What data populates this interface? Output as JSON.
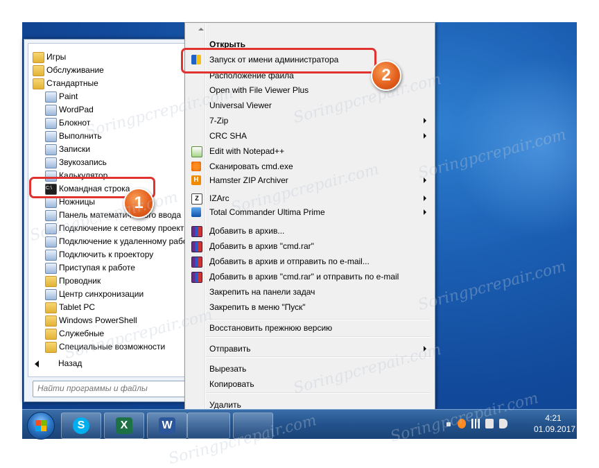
{
  "start_menu": {
    "programs": [
      {
        "label": "Игры",
        "icon": "folder-icon",
        "kind": "folder"
      },
      {
        "label": "Обслуживание",
        "icon": "folder-icon",
        "kind": "folder"
      },
      {
        "label": "Стандартные",
        "icon": "folder-icon",
        "kind": "folder-open"
      },
      {
        "label": "Paint",
        "icon": "paint-icon",
        "kind": "app"
      },
      {
        "label": "WordPad",
        "icon": "wordpad-icon",
        "kind": "app"
      },
      {
        "label": "Блокнот",
        "icon": "notepad-icon",
        "kind": "app"
      },
      {
        "label": "Выполнить",
        "icon": "run-icon",
        "kind": "app"
      },
      {
        "label": "Записки",
        "icon": "sticky-notes-icon",
        "kind": "app"
      },
      {
        "label": "Звукозапись",
        "icon": "sound-recorder-icon",
        "kind": "app"
      },
      {
        "label": "Калькулятор",
        "icon": "calculator-icon",
        "kind": "app"
      },
      {
        "label": "Командная строка",
        "icon": "cmd-icon",
        "kind": "cmd"
      },
      {
        "label": "Ножницы",
        "icon": "scissors-icon",
        "kind": "app"
      },
      {
        "label": "Панель математического ввода",
        "icon": "math-input-icon",
        "kind": "app"
      },
      {
        "label": "Подключение к сетевому проект",
        "icon": "network-projector-icon",
        "kind": "app"
      },
      {
        "label": "Подключение к удаленному рабо",
        "icon": "remote-desktop-icon",
        "kind": "app"
      },
      {
        "label": "Подключить к проектору",
        "icon": "projector-icon",
        "kind": "app"
      },
      {
        "label": "Приступая к работе",
        "icon": "getting-started-icon",
        "kind": "app"
      },
      {
        "label": "Проводник",
        "icon": "explorer-icon",
        "kind": "folder"
      },
      {
        "label": "Центр синхронизации",
        "icon": "sync-center-icon",
        "kind": "app"
      },
      {
        "label": "Tablet PC",
        "icon": "folder-icon",
        "kind": "folder"
      },
      {
        "label": "Windows PowerShell",
        "icon": "folder-icon",
        "kind": "folder"
      },
      {
        "label": "Служебные",
        "icon": "folder-icon",
        "kind": "folder"
      },
      {
        "label": "Специальные возможности",
        "icon": "folder-icon",
        "kind": "folder"
      }
    ],
    "back_label": "Назад",
    "search_placeholder": "Найти программы и файлы"
  },
  "context_menu": {
    "items": [
      {
        "label": "Открыть",
        "bold": true,
        "icon": "",
        "submenu": false
      },
      {
        "label": "Запуск от имени администратора",
        "bold": false,
        "icon": "uac-shield-icon",
        "submenu": false
      },
      {
        "label": "Расположение файла",
        "bold": false,
        "icon": "",
        "submenu": false
      },
      {
        "label": "Open with File Viewer Plus",
        "bold": false,
        "icon": "",
        "submenu": false
      },
      {
        "label": "Universal Viewer",
        "bold": false,
        "icon": "",
        "submenu": false
      },
      {
        "label": "7-Zip",
        "bold": false,
        "icon": "",
        "submenu": true
      },
      {
        "label": "CRC SHA",
        "bold": false,
        "icon": "",
        "submenu": true
      },
      {
        "label": "Edit with Notepad++",
        "bold": false,
        "icon": "notepad-plus-plus-icon",
        "submenu": false
      },
      {
        "label": "Сканировать cmd.exe",
        "bold": false,
        "icon": "avast-icon",
        "submenu": false
      },
      {
        "label": "Hamster ZIP Archiver",
        "bold": false,
        "icon": "hamster-icon",
        "submenu": true
      },
      {
        "label": "IZArc",
        "bold": false,
        "icon": "izarc-icon",
        "submenu": true
      },
      {
        "label": "Total Commander Ultima Prime",
        "bold": false,
        "icon": "total-commander-icon",
        "submenu": true
      },
      {
        "label": "Добавить в архив...",
        "bold": false,
        "icon": "winrar-icon",
        "submenu": false
      },
      {
        "label": "Добавить в архив \"cmd.rar\"",
        "bold": false,
        "icon": "winrar-icon",
        "submenu": false
      },
      {
        "label": "Добавить в архив и отправить по e-mail...",
        "bold": false,
        "icon": "winrar-icon",
        "submenu": false
      },
      {
        "label": "Добавить в архив \"cmd.rar\" и отправить по e-mail",
        "bold": false,
        "icon": "winrar-icon",
        "submenu": false
      },
      {
        "label": "Закрепить на панели задач",
        "bold": false,
        "icon": "",
        "submenu": false
      },
      {
        "label": "Закрепить в меню \"Пуск\"",
        "bold": false,
        "icon": "",
        "submenu": false
      },
      {
        "label": "Восстановить прежнюю версию",
        "bold": false,
        "icon": "",
        "submenu": false
      },
      {
        "label": "Отправить",
        "bold": false,
        "icon": "",
        "submenu": true
      },
      {
        "label": "Вырезать",
        "bold": false,
        "icon": "",
        "submenu": false
      },
      {
        "label": "Копировать",
        "bold": false,
        "icon": "",
        "submenu": false
      },
      {
        "label": "Удалить",
        "bold": false,
        "icon": "",
        "submenu": false
      }
    ]
  },
  "taskbar": {
    "pinned": [
      {
        "name": "skype-icon",
        "glyph": "S",
        "color": "#00aff0"
      },
      {
        "name": "excel-icon",
        "glyph": "X",
        "color": "#1e7145"
      },
      {
        "name": "word-icon",
        "glyph": "W",
        "color": "#2b579a"
      }
    ],
    "clock_time": "4:21",
    "clock_date": "01.09.2017"
  },
  "callouts": [
    {
      "number": "1"
    },
    {
      "number": "2"
    }
  ],
  "watermark": "Soringpcrepair.com",
  "colors": {
    "accent_red": "#e0332f",
    "badge_orange": "#e5601d",
    "desktop_blue": "#1b5fb3"
  }
}
